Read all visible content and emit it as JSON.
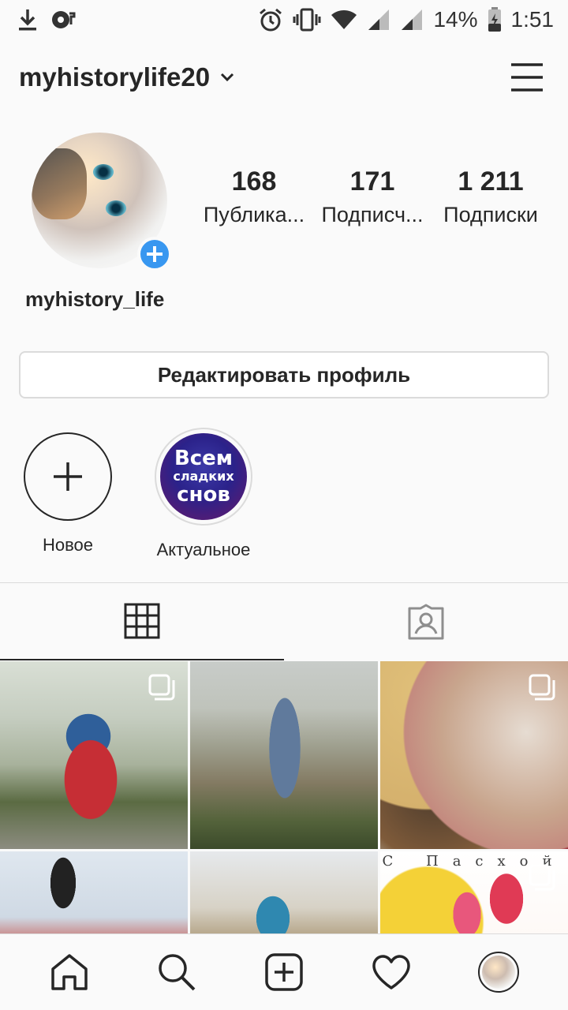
{
  "status_bar": {
    "battery_percent": "14%",
    "time": "1:51",
    "icons": [
      "download-icon",
      "media-icon",
      "alarm-icon",
      "vibrate-icon",
      "wifi-icon",
      "signal-icon",
      "signal-icon",
      "battery-icon"
    ]
  },
  "header": {
    "username": "myhistorylife20"
  },
  "profile": {
    "display_name": "myhistory_life",
    "stats": [
      {
        "value": "168",
        "label": "Публика..."
      },
      {
        "value": "171",
        "label": "Подписч..."
      },
      {
        "value": "1 211",
        "label": "Подписки"
      }
    ],
    "edit_button": "Редактировать профиль"
  },
  "highlights": {
    "new_label": "Новое",
    "items": [
      {
        "label": "Актуальное",
        "cover_text": [
          "Всем",
          "сладких",
          "снов"
        ]
      }
    ]
  },
  "grid_overlay_text": "С Пасхой",
  "colors": {
    "accent_blue": "#3897f0",
    "text_primary": "#262626",
    "border": "#dbdbdb",
    "background": "#fafafa"
  }
}
